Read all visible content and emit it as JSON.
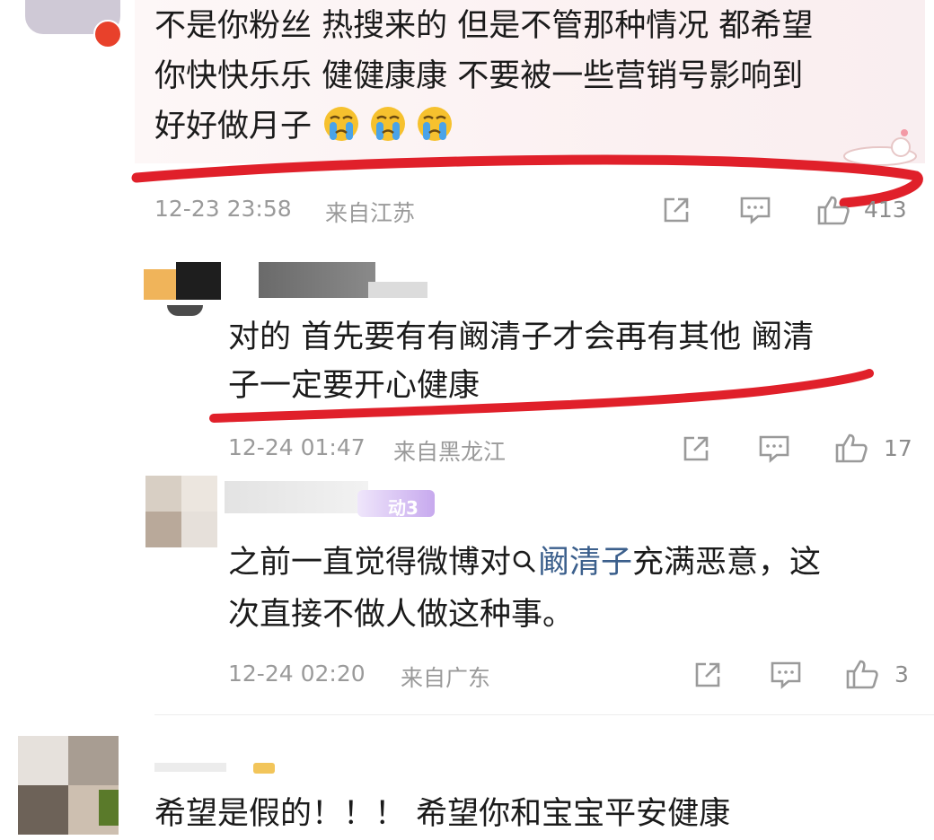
{
  "comments": [
    {
      "lines": [
        "不是你粉丝 热搜来的 但是不管那种情况 都希望",
        "你快快乐乐 健健康康 不要被一些营销号影响到",
        "好好做月子"
      ],
      "emoji_count": 3,
      "emoji_icon": "crying-face-icon",
      "time": "12-23 23:58",
      "location": "来自江苏",
      "like_count": "413"
    },
    {
      "lines": [
        "对的 首先要有有阚清子才会再有其他 阚清",
        "子一定要开心健康"
      ],
      "time": "12-24 01:47",
      "location": "来自黑龙江",
      "like_count": "17"
    },
    {
      "line1_before": "之前一直觉得微博对",
      "topic": "阚清子",
      "line1_after": "充满恶意，这",
      "line2": "次直接不做人做这种事。",
      "badge_text": "动3",
      "time": "12-24 02:20",
      "location": "来自广东",
      "like_count": "3"
    },
    {
      "lines": [
        "希望是假的！！！ 希望你和宝宝平安健康"
      ]
    }
  ],
  "colors": {
    "accent_red": "#e0202a",
    "meta_gray": "#9a9a9a",
    "topic_blue": "#3b5f8c",
    "badge_purple": "#c7a9ee"
  }
}
